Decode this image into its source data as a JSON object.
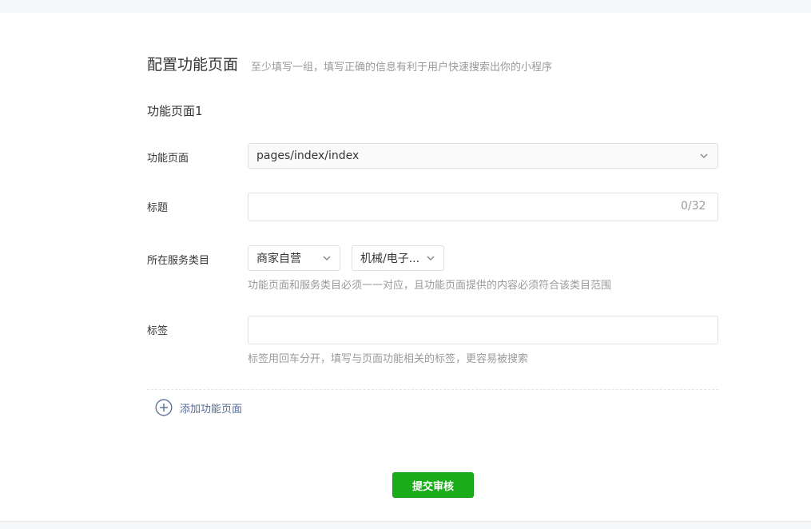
{
  "header": {
    "title": "配置功能页面",
    "subtitle": "至少填写一组，填写正确的信息有利于用户快速搜索出你的小程序"
  },
  "section": {
    "title": "功能页面1"
  },
  "form": {
    "page": {
      "label": "功能页面",
      "value": "pages/index/index",
      "icon": "chevron-down-icon"
    },
    "title": {
      "label": "标题",
      "value": "",
      "counter": "0/32"
    },
    "category": {
      "label": "所在服务类目",
      "primary": "商家自营",
      "secondary": "机械/电子...",
      "hint": "功能页面和服务类目必须一一对应，且功能页面提供的内容必须符合该类目范围"
    },
    "tags": {
      "label": "标签",
      "value": "",
      "hint": "标签用回车分开，填写与页面功能相关的标签，更容易被搜索"
    }
  },
  "add_page": {
    "label": "添加功能页面",
    "icon": "plus-circle-icon"
  },
  "submit": {
    "label": "提交审核"
  },
  "colors": {
    "primary": "#1aad19",
    "link": "#576b95",
    "muted": "#9a9a9a",
    "border": "#e0e0e0"
  }
}
